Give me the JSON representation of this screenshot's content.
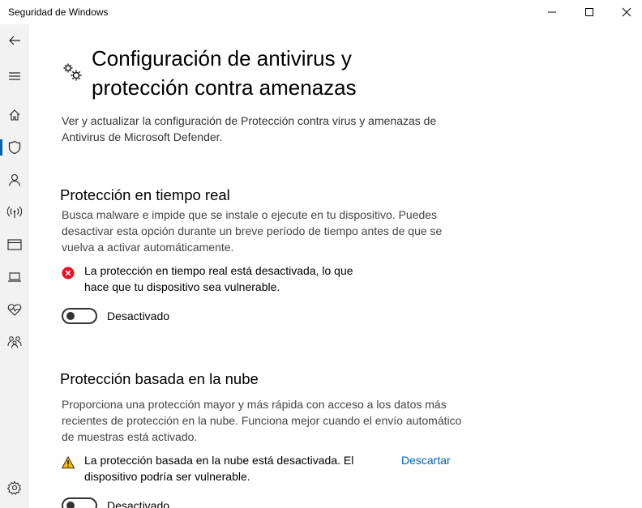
{
  "window": {
    "title": "Seguridad de Windows"
  },
  "sidebar": {
    "items": [
      {
        "icon": "back-arrow-icon"
      },
      {
        "icon": "hamburger-menu-icon"
      },
      {
        "icon": "home-icon"
      },
      {
        "icon": "shield-icon",
        "active": true
      },
      {
        "icon": "person-icon"
      },
      {
        "icon": "wifi-antenna-icon"
      },
      {
        "icon": "app-browser-icon"
      },
      {
        "icon": "laptop-icon"
      },
      {
        "icon": "heart-pulse-icon"
      },
      {
        "icon": "family-icon"
      },
      {
        "icon": "settings-gear-icon"
      }
    ]
  },
  "page": {
    "title_line1": "Configuración de antivirus y",
    "title_line2": "protección contra amenazas",
    "description": "Ver y actualizar la configuración de Protección contra virus y amenazas de Antivirus de Microsoft Defender."
  },
  "sections": {
    "realtime": {
      "title": "Protección en tiempo real",
      "description": "Busca malware e impide que se instale o ejecute en tu dispositivo. Puedes desactivar esta opción durante un breve período de tiempo antes de que se vuelva a activar automáticamente.",
      "alert": "La protección en tiempo real está desactivada, lo que hace que tu dispositivo sea vulnerable.",
      "alert_type": "error",
      "toggle_label": "Desactivado",
      "toggle_on": false
    },
    "cloud": {
      "title": "Protección basada en la nube",
      "description": "Proporciona una protección mayor y más rápida con acceso a los datos más recientes de protección en la nube. Funciona mejor cuando el envío automático de muestras está activado.",
      "alert": "La protección basada en la nube está desactivada. El dispositivo podría ser vulnerable.",
      "alert_type": "warning",
      "dismiss_label": "Descartar",
      "toggle_label": "Desactivado",
      "toggle_on": false
    }
  },
  "colors": {
    "accent": "#0063b1",
    "error": "#e81123",
    "warning": "#ffb900",
    "sidebar_bg": "#f2f2f2"
  }
}
